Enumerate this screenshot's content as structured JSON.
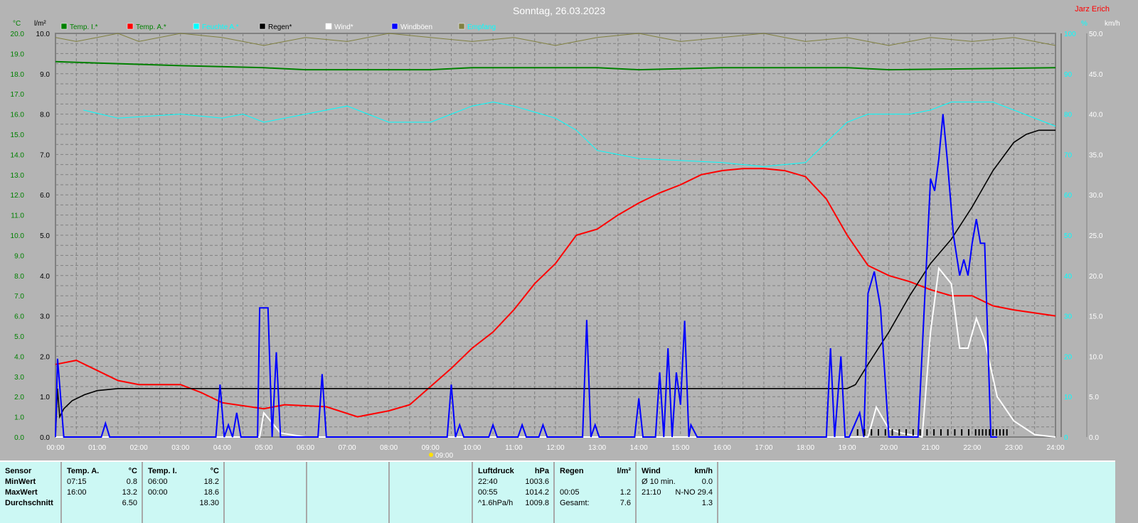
{
  "title": "Sonntag, 26.03.2023",
  "author": "Jarz Erich",
  "colors": {
    "temp_i": "#008000",
    "temp_a": "#ff0000",
    "feuchte": "#00ffff",
    "regen": "#000000",
    "wind": "#ffffff",
    "windboeen": "#0000ff",
    "empfang": "#808040"
  },
  "sunrise_label": "09:00",
  "chart_data": {
    "type": "line",
    "title": "Sonntag, 26.03.2023",
    "x_unit": "hours",
    "xlim": [
      0,
      24
    ],
    "x_ticks": [
      "00:00",
      "01:00",
      "02:00",
      "03:00",
      "04:00",
      "05:00",
      "06:00",
      "07:00",
      "08:00",
      "09:00",
      "10:00",
      "11:00",
      "12:00",
      "13:00",
      "14:00",
      "15:00",
      "16:00",
      "17:00",
      "18:00",
      "19:00",
      "20:00",
      "21:00",
      "22:00",
      "23:00",
      "24:00"
    ],
    "axes": {
      "temp": {
        "label": "°C",
        "range": [
          0,
          20
        ],
        "ticks": [
          "0.0",
          "1.0",
          "2.0",
          "3.0",
          "4.0",
          "5.0",
          "6.0",
          "7.0",
          "8.0",
          "9.0",
          "10.0",
          "11.0",
          "12.0",
          "13.0",
          "14.0",
          "15.0",
          "16.0",
          "17.0",
          "18.0",
          "19.0",
          "20.0"
        ]
      },
      "rain": {
        "label": "l/m²",
        "range": [
          0,
          10
        ],
        "ticks": [
          "0.0",
          "1.0",
          "2.0",
          "3.0",
          "4.0",
          "5.0",
          "6.0",
          "7.0",
          "8.0",
          "9.0",
          "10.0"
        ]
      },
      "humidity": {
        "label": "%",
        "range": [
          0,
          100
        ],
        "ticks": [
          "0",
          "10",
          "20",
          "30",
          "40",
          "50",
          "60",
          "70",
          "80",
          "90",
          "100"
        ]
      },
      "wind": {
        "label": "km/h",
        "range": [
          0,
          50
        ],
        "ticks": [
          "0.0",
          "5.0",
          "10.0",
          "15.0",
          "20.0",
          "25.0",
          "30.0",
          "35.0",
          "40.0",
          "45.0",
          "50.0"
        ]
      }
    },
    "legend": [
      {
        "name": "Temp. I.*",
        "key": "temp_i"
      },
      {
        "name": "Temp. A.*",
        "key": "temp_a"
      },
      {
        "name": "Feuchte A.*",
        "key": "feuchte"
      },
      {
        "name": "Regen*",
        "key": "regen"
      },
      {
        "name": "Wind*",
        "key": "wind"
      },
      {
        "name": "Windböen",
        "key": "windboeen"
      },
      {
        "name": "Empfang",
        "key": "empfang"
      }
    ],
    "series": [
      {
        "name": "Temp. I.*",
        "key": "temp_i",
        "axis": "temp",
        "x": [
          0,
          3,
          5,
          6,
          9,
          10,
          13,
          14,
          16,
          19,
          20,
          24
        ],
        "y": [
          18.6,
          18.4,
          18.3,
          18.2,
          18.2,
          18.3,
          18.3,
          18.2,
          18.3,
          18.3,
          18.2,
          18.3
        ]
      },
      {
        "name": "Feuchte A.*",
        "key": "feuchte",
        "axis": "humidity",
        "x": [
          0.67,
          1.5,
          3,
          4,
          4.5,
          5,
          6,
          7,
          8,
          9,
          10,
          10.5,
          11,
          12,
          12.5,
          13,
          13.5,
          14,
          15,
          16,
          17,
          18,
          18.5,
          19,
          19.5,
          20,
          20.5,
          21,
          21.5,
          22,
          22.5,
          23,
          24
        ],
        "y": [
          81,
          79,
          80,
          79,
          80,
          78,
          80,
          82,
          78,
          78,
          82,
          83,
          82,
          79,
          76,
          71,
          70,
          69,
          68.5,
          68,
          67,
          68,
          73,
          78,
          80,
          80,
          80,
          81,
          83,
          83,
          83,
          81,
          77
        ]
      },
      {
        "name": "Temp. A.*",
        "key": "temp_a",
        "axis": "temp",
        "x": [
          0,
          0.5,
          1,
          1.5,
          2,
          3,
          3.5,
          4,
          5,
          5.5,
          6.5,
          7.25,
          8,
          8.5,
          9,
          9.5,
          10,
          10.5,
          11,
          11.5,
          12,
          12.5,
          13,
          13.5,
          14,
          14.5,
          15,
          15.5,
          16,
          16.5,
          17,
          17.5,
          18,
          18.5,
          19,
          19.5,
          20,
          20.5,
          21,
          21.5,
          22,
          22.5,
          23,
          24
        ],
        "y": [
          3.6,
          3.8,
          3.3,
          2.8,
          2.6,
          2.6,
          2.2,
          1.7,
          1.4,
          1.6,
          1.5,
          1.0,
          1.3,
          1.6,
          2.5,
          3.4,
          4.4,
          5.2,
          6.3,
          7.6,
          8.6,
          10.0,
          10.3,
          11.0,
          11.6,
          12.1,
          12.5,
          13.0,
          13.2,
          13.3,
          13.3,
          13.2,
          12.9,
          11.8,
          10.0,
          8.5,
          8.0,
          7.7,
          7.3,
          7.0,
          7.0,
          6.5,
          6.3,
          6.0
        ]
      },
      {
        "name": "Regen*",
        "key": "regen",
        "axis": "rain",
        "x": [
          0,
          0.05,
          0.1,
          0.2,
          0.4,
          0.7,
          1,
          1.5,
          19,
          19.2,
          19.5,
          20,
          20.5,
          21,
          21.5,
          22,
          22.5,
          23,
          23.3,
          23.6,
          24
        ],
        "y": [
          0,
          1.2,
          0.5,
          0.7,
          0.9,
          1.05,
          1.15,
          1.2,
          1.2,
          1.3,
          1.8,
          2.6,
          3.5,
          4.3,
          4.9,
          5.7,
          6.6,
          7.3,
          7.5,
          7.6,
          7.6
        ]
      },
      {
        "name": "Wind*",
        "key": "wind",
        "axis": "wind",
        "x": [
          0,
          4.9,
          5.0,
          5.4,
          6,
          19.5,
          19.7,
          20,
          20.3,
          20.8,
          21,
          21.2,
          21.5,
          21.7,
          21.9,
          22.1,
          22.3,
          22.6,
          23,
          23.5,
          24
        ],
        "y": [
          0,
          0,
          3,
          0.5,
          0,
          0,
          3.7,
          1,
          0.5,
          0,
          13,
          20.9,
          19,
          11,
          11,
          14.7,
          12,
          5,
          2,
          0.3,
          0
        ]
      },
      {
        "name": "Windböen",
        "key": "windboeen",
        "axis": "wind",
        "x": [
          0,
          0.05,
          0.2,
          1.1,
          1.2,
          1.3,
          3.85,
          3.95,
          4.05,
          4.15,
          4.25,
          4.35,
          4.45,
          4.85,
          4.9,
          5.1,
          5.2,
          5.3,
          5.4,
          6.3,
          6.4,
          6.5,
          9.4,
          9.5,
          9.6,
          9.7,
          9.8,
          10.4,
          10.5,
          10.6,
          11.1,
          11.2,
          11.3,
          11.6,
          11.7,
          11.8,
          12.65,
          12.75,
          12.85,
          12.95,
          13.05,
          13.9,
          14.0,
          14.1,
          14.4,
          14.5,
          14.6,
          14.7,
          14.8,
          14.9,
          15.0,
          15.1,
          15.2,
          15.25,
          15.4,
          15.5,
          15.6,
          18.5,
          18.6,
          18.7,
          18.85,
          18.95,
          19.05,
          19.3,
          19.4,
          19.5,
          19.65,
          19.8,
          20.0,
          20.05,
          20.7,
          21.0,
          21.1,
          21.2,
          21.3,
          21.4,
          21.55,
          21.7,
          21.8,
          21.9,
          22.0,
          22.1,
          22.2,
          22.3,
          22.45,
          22.6
        ],
        "y": [
          0,
          9.7,
          0,
          0,
          1.7,
          0,
          0,
          6.5,
          0,
          1.5,
          0,
          3,
          0,
          0,
          16,
          16,
          0,
          10.5,
          0,
          0,
          7.8,
          0,
          0,
          6.5,
          0,
          1.5,
          0,
          0,
          1.5,
          0,
          0,
          1.5,
          0,
          0,
          1.5,
          0,
          0,
          14.5,
          0,
          1.5,
          0,
          0,
          4.8,
          0,
          0,
          8,
          0,
          11,
          0,
          8,
          4,
          14.4,
          0,
          1.5,
          0,
          0,
          0,
          0,
          11,
          0,
          10,
          0,
          0,
          3,
          0,
          17.8,
          20.5,
          16,
          0,
          0,
          0,
          32,
          30.5,
          34.5,
          40,
          34.5,
          25,
          20,
          22,
          20,
          24,
          27,
          24,
          24,
          0,
          0
        ]
      },
      {
        "name": "Empfang",
        "key": "empfang",
        "axis": "humidity",
        "x": [
          0,
          0.5,
          1,
          1.5,
          2,
          3,
          4,
          5,
          6,
          7,
          8,
          9,
          10,
          11,
          12,
          13,
          14,
          15,
          16,
          17,
          18,
          19,
          20,
          21,
          22,
          23,
          24
        ],
        "y": [
          99,
          98,
          99,
          100,
          98,
          100,
          99,
          97,
          99,
          98,
          100,
          99,
          98,
          99,
          97,
          99,
          100,
          98,
          99,
          100,
          98,
          99,
          97,
          99,
          98,
          99,
          97
        ]
      }
    ],
    "rain_marks_range": [
      "19:10",
      "22:50"
    ]
  },
  "table": {
    "sensor": {
      "header": "Sensor",
      "rows": [
        "MinWert",
        "MaxWert",
        "Durchschnitt"
      ]
    },
    "temp_a": {
      "header": "Temp. A.",
      "unit": "°C",
      "rows": [
        [
          "07:15",
          "0.8"
        ],
        [
          "16:00",
          "13.2"
        ],
        [
          "",
          "6.50"
        ]
      ]
    },
    "temp_i": {
      "header": "Temp. I.",
      "unit": "°C",
      "rows": [
        [
          "06:00",
          "18.2"
        ],
        [
          "00:00",
          "18.6"
        ],
        [
          "",
          "18.30"
        ]
      ]
    },
    "luftdruck": {
      "header": "Luftdruck",
      "unit": "hPa",
      "rows": [
        [
          "22:40",
          "1003.6"
        ],
        [
          "00:55",
          "1014.2"
        ],
        [
          "^1.6hPa/h",
          "1009.8"
        ]
      ]
    },
    "regen": {
      "header": "Regen",
      "unit": "l/m²",
      "rows": [
        [
          "",
          ""
        ],
        [
          "00:05",
          "1.2"
        ],
        [
          "Gesamt:",
          "7.6"
        ]
      ]
    },
    "wind": {
      "header": "Wind",
      "unit": "km/h",
      "rows": [
        [
          "Ø 10 min.",
          "0.0"
        ],
        [
          "21:10",
          "N-NO 29.4"
        ],
        [
          "",
          "1.3"
        ]
      ]
    }
  }
}
